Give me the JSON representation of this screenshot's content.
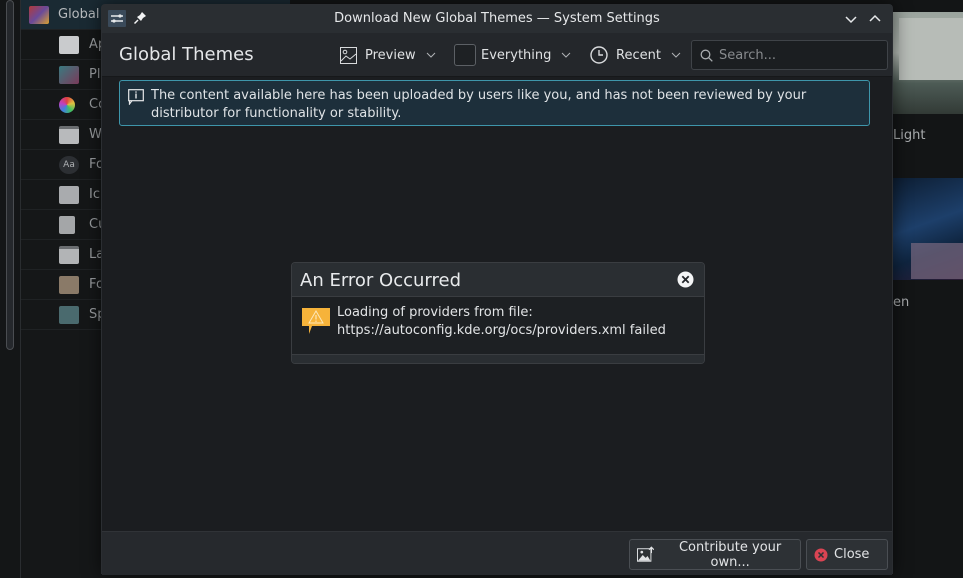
{
  "background": {
    "sidebar": {
      "items": [
        {
          "label": "Global",
          "icon": "global-theme-icon"
        },
        {
          "label": "Ap",
          "icon": "application-style-icon"
        },
        {
          "label": "Pl",
          "icon": "plasma-style-icon"
        },
        {
          "label": "Co",
          "icon": "colors-icon"
        },
        {
          "label": "W",
          "icon": "window-decorations-icon"
        },
        {
          "label": "Fo",
          "icon": "fonts-icon"
        },
        {
          "label": "Ic",
          "icon": "icons-icon"
        },
        {
          "label": "Cu",
          "icon": "cursors-icon"
        },
        {
          "label": "La",
          "icon": "launch-feedback-icon"
        },
        {
          "label": "Fo",
          "icon": "font-management-icon"
        },
        {
          "label": "Sp",
          "icon": "splash-screen-icon"
        }
      ]
    },
    "theme_captions": [
      "Light",
      "en"
    ]
  },
  "window": {
    "title": "Download New Global Themes — System Settings",
    "icons": {
      "app": "settings-app-icon",
      "pin": "pin-icon",
      "minimize": "chevron-down-icon",
      "maximize": "chevron-up-icon"
    }
  },
  "toolbar": {
    "page_title": "Global Themes",
    "preview_label": "Preview",
    "filter_label": "Everything",
    "sort_label": "Recent",
    "search_placeholder": "Search...",
    "search_value": ""
  },
  "info_banner": {
    "message": "The content available here has been uploaded by users like you, and has not been reviewed by your distributor for functionality or stability."
  },
  "error_dialog": {
    "title": "An Error Occurred",
    "message": "Loading of providers from file: https://autoconfig.kde.org/ocs/providers.xml failed"
  },
  "footer": {
    "contribute_label": "Contribute your own...",
    "close_label": "Close"
  },
  "colors": {
    "accent": "#3e96ab",
    "warning": "#f6b33a",
    "error": "#da4453"
  }
}
